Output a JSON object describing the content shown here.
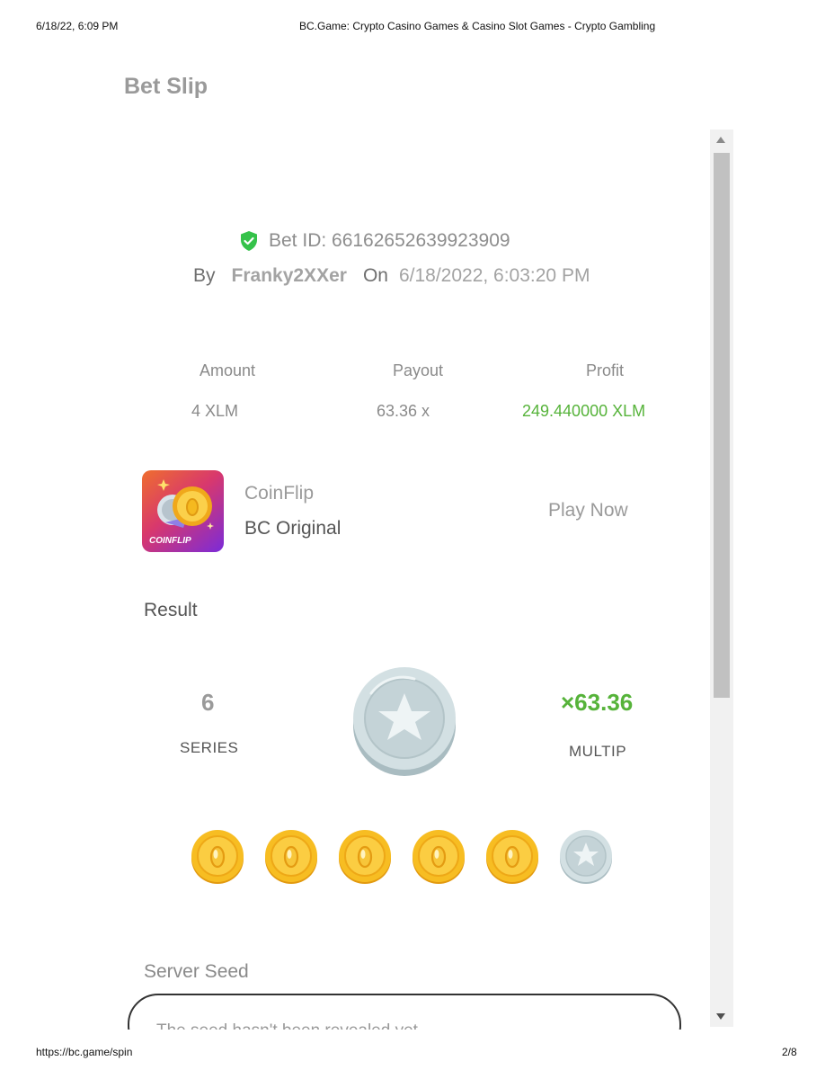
{
  "print_header": {
    "datetime": "6/18/22, 6:09 PM",
    "doc_title": "BC.Game: Crypto Casino Games & Casino Slot Games - Crypto Gambling"
  },
  "print_footer": {
    "url": "https://bc.game/spin",
    "page": "2/8"
  },
  "modal": {
    "title": "Bet Slip"
  },
  "bet": {
    "id_label": "Bet ID: 66162652639923909",
    "by_label": "By",
    "user": "Franky2XXer",
    "on_label": "On",
    "date": "6/18/2022, 6:03:20 PM"
  },
  "stats": {
    "amount_label": "Amount",
    "amount_value": "4 XLM",
    "payout_label": "Payout",
    "payout_value": "63.36 x",
    "profit_label": "Profit",
    "profit_value": "249.440000 XLM"
  },
  "game": {
    "icon_text": "COINFLIP",
    "name": "CoinFlip",
    "provider": "BC Original",
    "play_label": "Play Now"
  },
  "result": {
    "label": "Result",
    "series_value": "6",
    "series_label": "SERIES",
    "multiplier_value": "×63.36",
    "multiplier_label": "MULTIP",
    "sequence": [
      "gold",
      "gold",
      "gold",
      "gold",
      "gold",
      "silver"
    ]
  },
  "seed": {
    "label": "Server Seed",
    "partial_text": "The seed hasn't been revealed yet"
  },
  "colors": {
    "profit_green": "#56b33a",
    "verified_green": "#35c24a",
    "coin_gold": "#f5b91f",
    "coin_silver": "#cfdde0"
  }
}
